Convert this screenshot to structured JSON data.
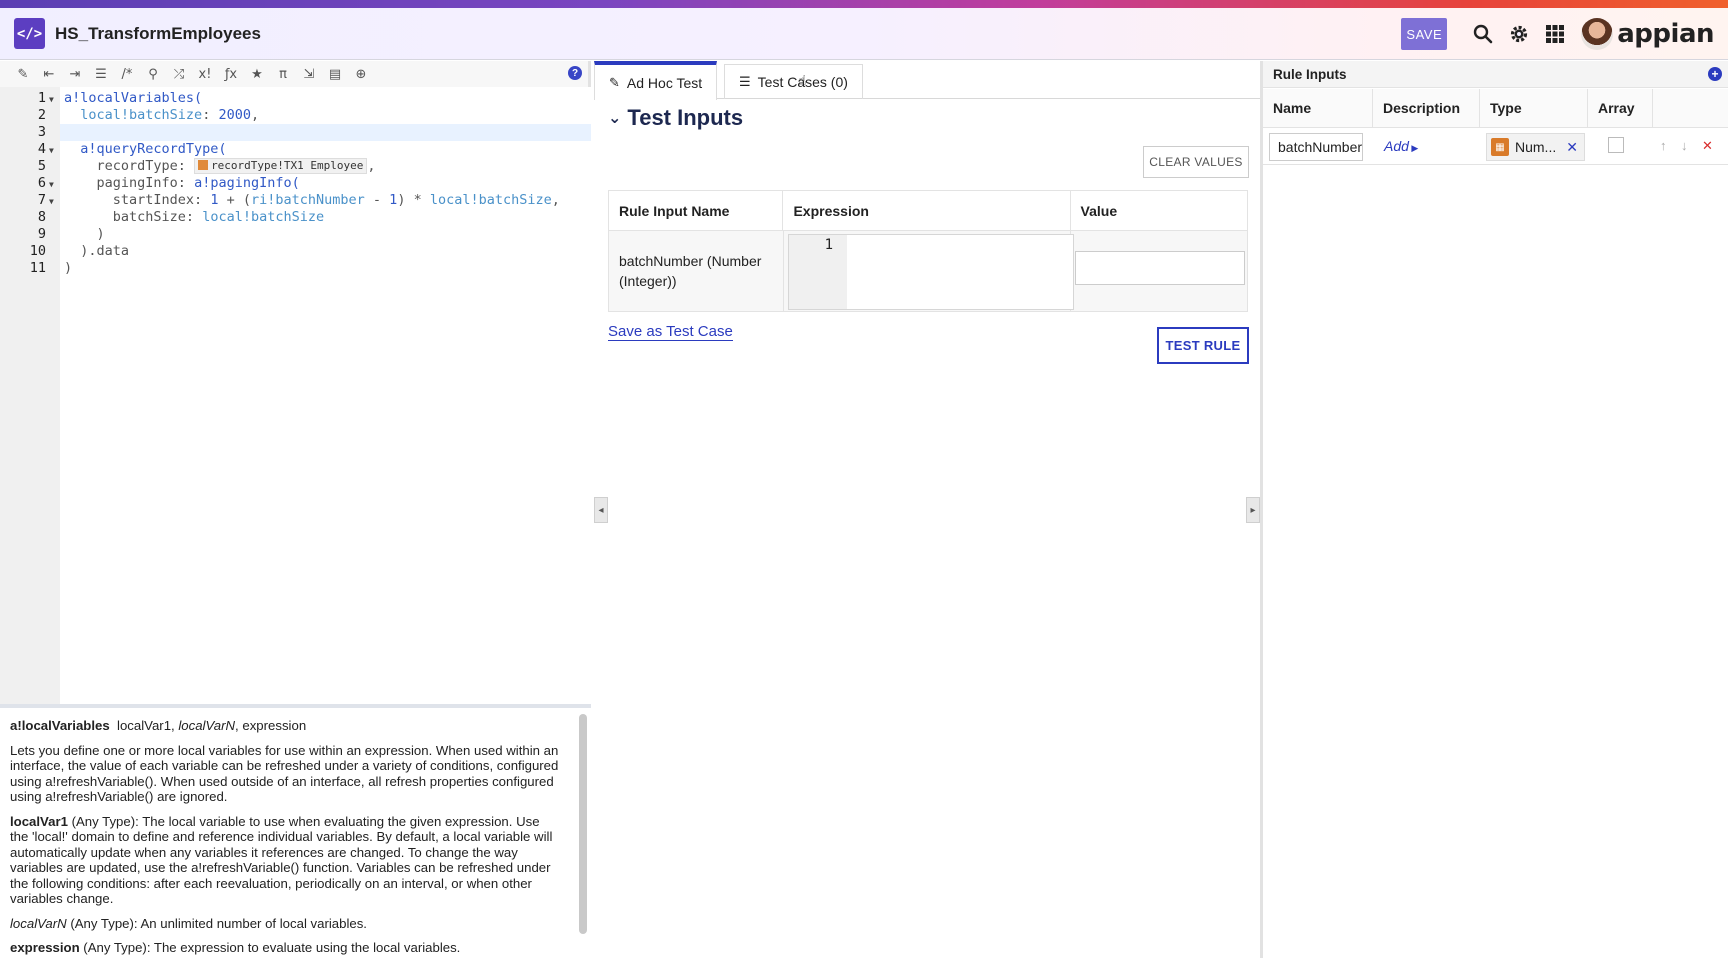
{
  "header": {
    "app_icon": "code-icon",
    "title": "HS_TransformEmployees",
    "save_label": "SAVE",
    "brand": "appian",
    "icons": [
      "search-icon",
      "gear-icon",
      "apps-grid-icon"
    ]
  },
  "editor": {
    "toolbar_icons": [
      "wand-icon",
      "outdent-icon",
      "indent-icon",
      "list-icon",
      "comment-icon",
      "search-icon",
      "shuffle-icon",
      "expression-icon",
      "function-icon",
      "star-icon",
      "pi-icon",
      "export-icon",
      "record-icon",
      "globe-icon"
    ],
    "help_label": "?",
    "record_chip": "recordType!TX1 Employee",
    "lines": [
      {
        "n": "1",
        "fold": true
      },
      {
        "n": "2",
        "fold": false
      },
      {
        "n": "3",
        "fold": false
      },
      {
        "n": "4",
        "fold": true
      },
      {
        "n": "5",
        "fold": false
      },
      {
        "n": "6",
        "fold": true
      },
      {
        "n": "7",
        "fold": true
      },
      {
        "n": "8",
        "fold": false
      },
      {
        "n": "9",
        "fold": false
      },
      {
        "n": "10",
        "fold": false
      },
      {
        "n": "11",
        "fold": false
      }
    ],
    "code": {
      "l1": "a!localVariables(",
      "l2_var": "local!batchSize",
      "l2_rest": ": ",
      "l2_num": "2000",
      "l2_comma": ",",
      "l4": "a!queryRecordType(",
      "l5_key": "recordType: ",
      "l5_comma": ",",
      "l6_key": "pagingInfo: ",
      "l6_fn": "a!pagingInfo(",
      "l7_key": "startIndex: ",
      "l7_num": "1",
      "l7_op1": " + (",
      "l7_var1": "ri!batchNumber",
      "l7_op2": " - ",
      "l7_num2": "1",
      "l7_op3": ") * ",
      "l7_var2": "local!batchSize",
      "l7_comma": ",",
      "l8_key": "batchSize: ",
      "l8_var": "local!batchSize",
      "l9": ")",
      "l10": ").data",
      "l11": ")"
    }
  },
  "docs": {
    "signature_fn": "a!localVariables",
    "signature_args_a": "localVar1, ",
    "signature_args_b": "localVarN",
    "signature_args_c": ", expression",
    "description": "Lets you define one or more local variables for use within an expression. When used within an interface, the value of each variable can be refreshed under a variety of conditions, configured using a!refreshVariable(). When used outside of an interface, all refresh properties configured using a!refreshVariable() are ignored.",
    "param1_name": "localVar1",
    "param1_desc": " (Any Type): The local variable to use when evaluating the given expression. Use the 'local!' domain to define and reference individual variables. By default, a local variable will automatically update when any variables it references are changed. To change the way variables are updated, use the a!refreshVariable() function. Variables can be refreshed under the following conditions: after each reevaluation, periodically on an interval, or when other variables change.",
    "param2_name": "localVarN",
    "param2_desc": " (Any Type): An unlimited number of local variables.",
    "param3_name": "expression",
    "param3_desc": " (Any Type): The expression to evaluate using the local variables."
  },
  "test_panel": {
    "tab_adhoc": "Ad Hoc Test",
    "tab_cases": "Test Cases (0)",
    "section_title": "Test Inputs",
    "clear_label": "CLEAR VALUES",
    "columns": [
      "Rule Input Name",
      "Expression",
      "Value"
    ],
    "input_name": "batchNumber (Number (Integer))",
    "expr_line": "1",
    "value": "",
    "save_case_label": "Save as Test Case",
    "test_rule_label": "TEST RULE"
  },
  "rule_inputs": {
    "title": "Rule Inputs",
    "columns": [
      "Name",
      "Description",
      "Type",
      "Array"
    ],
    "row": {
      "name": "batchNumber",
      "description_link": "Add",
      "type": "Num...",
      "array": false
    }
  },
  "colors": {
    "accent": "#2b3bbf",
    "app_icon": "#5c3ec1",
    "save_button": "#7e70d6"
  }
}
